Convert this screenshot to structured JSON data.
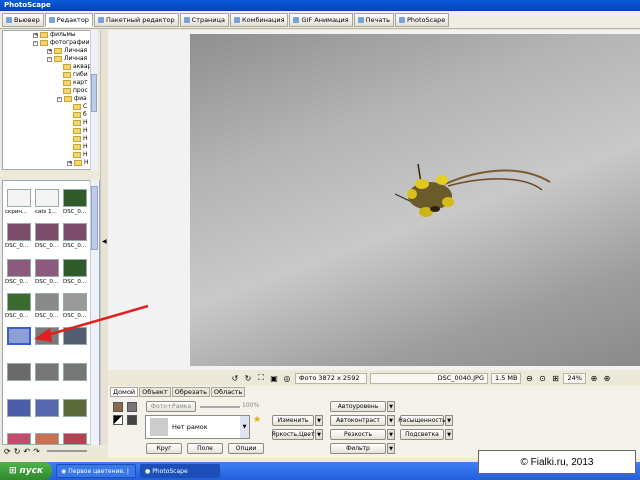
{
  "window": {
    "title": "PhotoScape"
  },
  "tabs": [
    {
      "label": "Вьювер",
      "icon": "viewer-icon"
    },
    {
      "label": "Редактор",
      "icon": "editor-icon",
      "active": true
    },
    {
      "label": "Пакетный редактор",
      "icon": "batch-icon"
    },
    {
      "label": "Страница",
      "icon": "page-icon"
    },
    {
      "label": "Комбинация",
      "icon": "combine-icon"
    },
    {
      "label": "GIF Анимация",
      "icon": "gif-icon"
    },
    {
      "label": "Печать",
      "icon": "print-icon"
    },
    {
      "label": "PhotoScape",
      "icon": "app-icon"
    }
  ],
  "tree": {
    "items": [
      "фильмы",
      "фотографии",
      "Личная",
      "Личная",
      "аквар",
      "гиби",
      "карт",
      "прос",
      "фиа",
      "С",
      "б",
      "Н",
      "Н",
      "Н",
      "Н",
      "Н",
      "Н"
    ]
  },
  "thumbnails": {
    "labels": [
      "скрин...",
      "cats 1...",
      "DSC_0...",
      "DSC_0...",
      "DSC_0...",
      "DSC_0...",
      "DSC_0...",
      "DSC_0...",
      "DSC_0...",
      "DSC_0...",
      "DSC_0...",
      "DSC_0..."
    ]
  },
  "status": {
    "photo_size": "Фото 3872 x 2592",
    "filename": "DSC_0040.JPG",
    "filesize": "1.5 MB",
    "zoom": "24%"
  },
  "panel": {
    "tabs": [
      "Домой",
      "Объект",
      "Обрезать",
      "Область"
    ],
    "frame_label": "Фото+Рамка",
    "frame_percent": "100%",
    "frame_value": "Нет рамок",
    "buttons": {
      "circle": "Круг",
      "field": "Поле",
      "options": "Опции"
    },
    "col1": {
      "resize": "Изменить",
      "brightness": "Яркость,Цвет"
    },
    "col2": {
      "autolevel": "Автоуровень",
      "autocontrast": "Автоконтраст",
      "sharpness": "Резкость",
      "filter": "Фильтр"
    },
    "col3": {
      "saturation": "Насыщенность",
      "backlight": "Подсветка"
    }
  },
  "taskbar": {
    "start": "пуск",
    "tasks": [
      "Первое цветение. |",
      "PhotoScape"
    ]
  },
  "watermark": "© Fialki.ru, 2013",
  "colors": {
    "accent": "#245edb",
    "arrow": "#e02020"
  }
}
